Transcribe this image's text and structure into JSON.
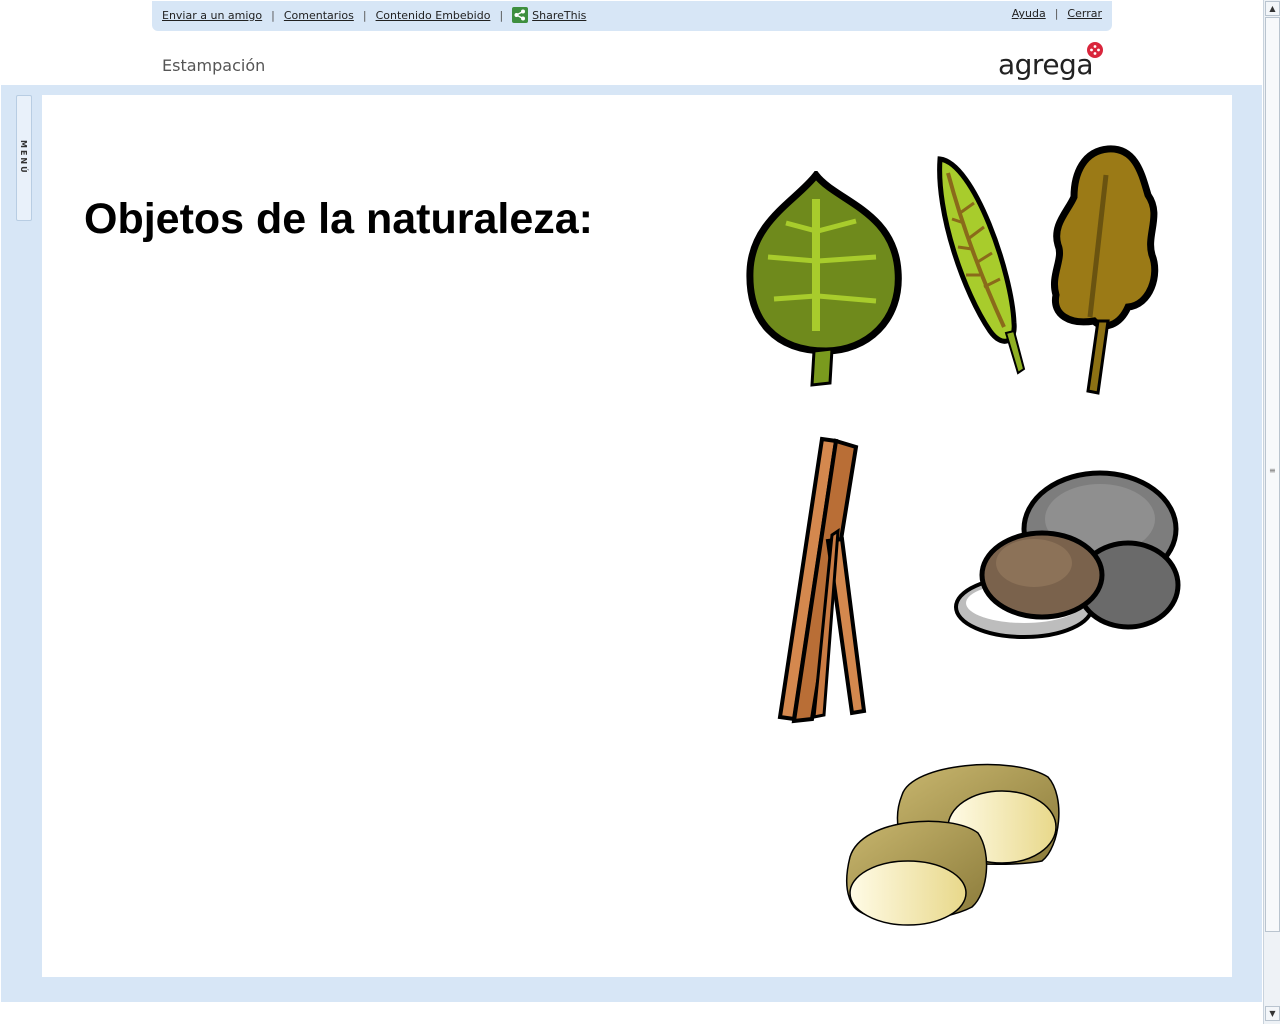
{
  "toolbar": {
    "links_left": [
      "Enviar a un amigo",
      "Comentarios",
      "Contenido Embebido"
    ],
    "sharethis": "ShareThis",
    "links_right": [
      "Ayuda",
      "Cerrar"
    ]
  },
  "header": {
    "course_title": "Estampación",
    "logo_text": "agrega"
  },
  "menu_tab": {
    "label": "MENÚ"
  },
  "slide": {
    "title": "Objetos de la naturaleza:"
  },
  "icons": {
    "leaf_round": "leaf-icon",
    "leaf_narrow": "leaf-icon",
    "leaf_dry": "leaf-icon",
    "sticks": "stick-icon",
    "stones": "stone-icon",
    "potatoes": "potato-icon"
  },
  "colors": {
    "frame": "#d7e6f6",
    "leaf_green": "#6f8a1c",
    "leaf_light": "#a8cc2c",
    "leaf_brown": "#9b7a16",
    "stick": "#d4884e",
    "stone_grey": "#7d7d7d",
    "stone_brown": "#7a624c",
    "potato": "#c8b66e",
    "logo_red": "#d9263c"
  }
}
